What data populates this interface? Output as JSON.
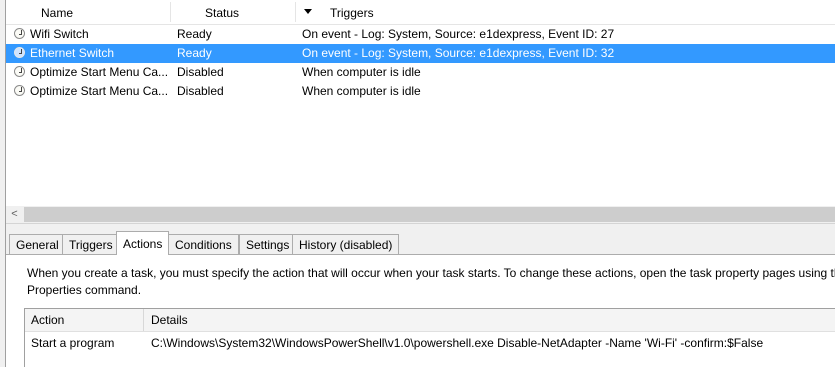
{
  "columns": {
    "name": "Name",
    "status": "Status",
    "triggers": "Triggers"
  },
  "tasks": [
    {
      "name": "Wifi Switch",
      "status": "Ready",
      "trigger": "On event - Log: System, Source: e1dexpress, Event ID: 27",
      "selected": false
    },
    {
      "name": "Ethernet Switch",
      "status": "Ready",
      "trigger": "On event - Log: System, Source: e1dexpress, Event ID: 32",
      "selected": true
    },
    {
      "name": "Optimize Start Menu Ca...",
      "status": "Disabled",
      "trigger": "When computer is idle",
      "selected": false
    },
    {
      "name": "Optimize Start Menu Ca...",
      "status": "Disabled",
      "trigger": "When computer is idle",
      "selected": false
    }
  ],
  "scroll_left_arrow": "<",
  "tabs": [
    {
      "label": "General"
    },
    {
      "label": "Triggers"
    },
    {
      "label": "Actions"
    },
    {
      "label": "Conditions"
    },
    {
      "label": "Settings"
    },
    {
      "label": "History (disabled)"
    }
  ],
  "active_tab": "Actions",
  "actions_panel": {
    "description_line1": "When you create a task, you must specify the action that will occur when your task starts.  To change these actions, open the task property pages using the",
    "description_line2": "Properties command.",
    "table_headers": {
      "action": "Action",
      "details": "Details"
    },
    "rows": [
      {
        "action": "Start a program",
        "details": "C:\\Windows\\System32\\WindowsPowerShell\\v1.0\\powershell.exe Disable-NetAdapter -Name 'Wi-Fi' -confirm:$False"
      }
    ]
  },
  "colors": {
    "selection": "#3399ff",
    "background": "#ffffff",
    "chrome": "#f0f0f0"
  },
  "icons": {
    "task": "clock-icon",
    "sort": "sort-descending-icon"
  }
}
